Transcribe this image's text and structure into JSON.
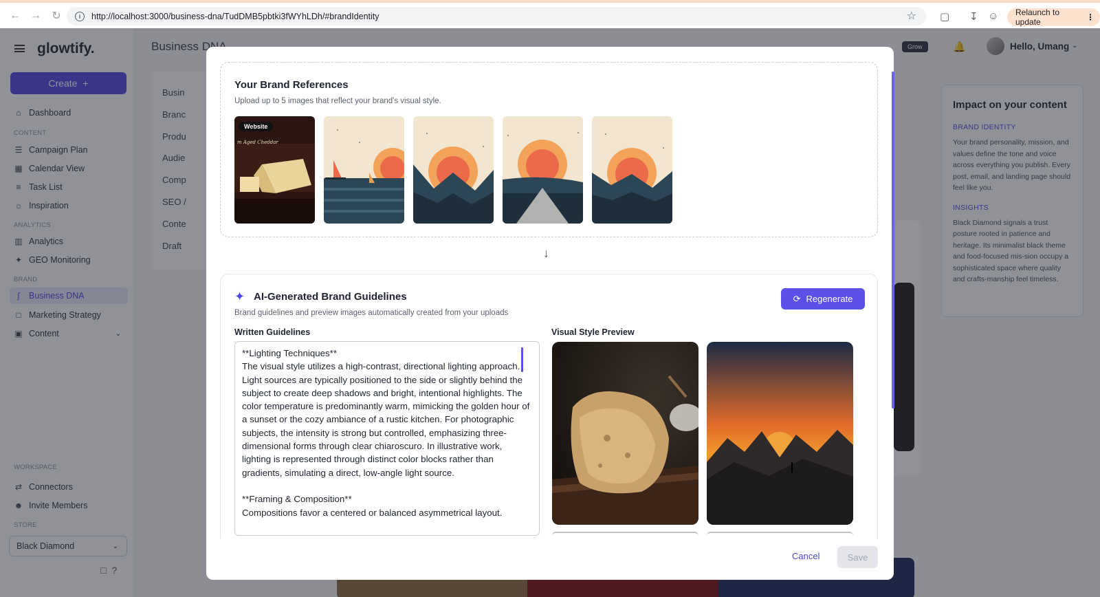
{
  "browser": {
    "url": "http://localhost:3000/business-dna/TudDMB5pbtki3fWYhLDh/#brandIdentity",
    "relaunch_label": "Relaunch to update"
  },
  "app": {
    "logo": "glowtify.",
    "create_label": "Create",
    "page_title": "Business DNA",
    "grow_badge": "Grow",
    "greeting": "Hello, Umang"
  },
  "sidebar": {
    "dashboard": "Dashboard",
    "content_section": "CONTENT",
    "content_items": [
      "Campaign Plan",
      "Calendar View",
      "Task List",
      "Inspiration"
    ],
    "analytics_section": "ANALYTICS",
    "analytics_items": [
      "Analytics",
      "GEO Monitoring"
    ],
    "brand_section": "BRAND",
    "brand_items": [
      "Business DNA",
      "Marketing Strategy",
      "Content"
    ],
    "workspace_section": "WORKSPACE",
    "workspace_items": [
      "Connectors",
      "Invite Members"
    ],
    "store_section": "STORE",
    "store_value": "Black Diamond"
  },
  "subnav": {
    "items": [
      "Busin",
      "Branc",
      "Produ",
      "Audie",
      "Comp",
      "SEO /",
      "Conte",
      "Draft"
    ]
  },
  "impact": {
    "title": "Impact on your content",
    "brand_identity_heading": "BRAND IDENTITY",
    "brand_identity_text": "Your brand personality, mission, and values define the tone and voice across everything you publish. Every post, email, and landing page should feel like you.",
    "insights_heading": "INSIGHTS",
    "insights_text": "Black Diamond signals a trust posture rooted in patience and heritage. Its minimalist black theme and food-focused mis-sion occupy a sophisticated space where quality and crafts-manship feel timeless."
  },
  "modal": {
    "refs_title": "Your Brand References",
    "refs_subtitle": "Upload up to 5 images that reflect your brand's visual style.",
    "website_tag": "Website",
    "thumb1_caption": "m Aged Cheddar",
    "guidelines_title": "AI-Generated Brand Guidelines",
    "guidelines_subtitle": "Brand guidelines and preview images automatically created from your uploads",
    "regenerate_label": "Regenerate",
    "written_label": "Written Guidelines",
    "visual_label": "Visual Style Preview",
    "written_text": "**Lighting Techniques**\nThe visual style utilizes a high-contrast, directional lighting approach. Light sources are typically positioned to the side or slightly behind the subject to create deep shadows and bright, intentional highlights. The color temperature is predominantly warm, mimicking the golden hour of a sunset or the cozy ambiance of a rustic kitchen. For photographic subjects, the intensity is strong but controlled, emphasizing three-dimensional forms through clear chiaroscuro. In illustrative work, lighting is represented through distinct color blocks rather than gradients, simulating a direct, low-angle light source.\n\n**Framing & Composition**\nCompositions favor a centered or balanced asymmetrical layout.",
    "cancel_label": "Cancel",
    "save_label": "Save"
  },
  "colors": {
    "accent": "#4f46e5",
    "sunset_cream": "#f3e6d0",
    "sunset_orange": "#f3a25a",
    "sunset_red": "#ea6a4a",
    "navy": "#2d4656"
  }
}
